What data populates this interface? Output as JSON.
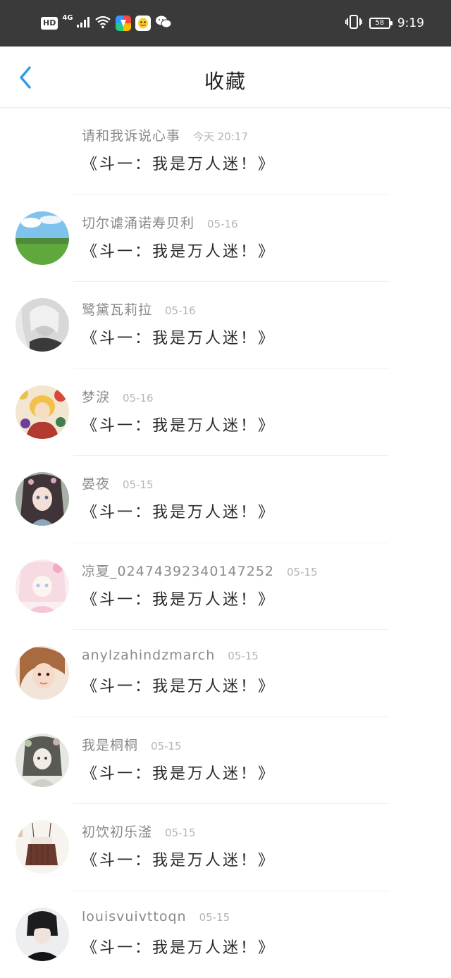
{
  "status_bar": {
    "left_badges": [
      "HD",
      "4G"
    ],
    "time": "9:19",
    "battery": "58",
    "icons": [
      "signal-icon",
      "wifi-icon",
      "app-icon-colorful",
      "app-icon-qq",
      "wechat-icon",
      "vibrate-icon",
      "battery-icon"
    ]
  },
  "header": {
    "title": "收藏",
    "back_icon": "back-chevron-icon"
  },
  "colors": {
    "accent": "#2d9be8",
    "status_bar_bg": "#3a3a3a",
    "username_gray": "#8a8a8a",
    "date_gray": "#b5b5b5"
  },
  "items": [
    {
      "username": "请和我诉说心事",
      "date": "今天 20:17",
      "title": "《斗一：我是万人迷！》",
      "avatar": "none"
    },
    {
      "username": "切尔谑涌诺寿贝利",
      "date": "05-16",
      "title": "《斗一：我是万人迷！》",
      "avatar": "landscape"
    },
    {
      "username": "鹭黛瓦莉拉",
      "date": "05-16",
      "title": "《斗一：我是万人迷！》",
      "avatar": "portrait-bw"
    },
    {
      "username": "梦淚",
      "date": "05-16",
      "title": "《斗一：我是万人迷！》",
      "avatar": "anime-colorful"
    },
    {
      "username": "晏夜",
      "date": "05-15",
      "title": "《斗一：我是万人迷！》",
      "avatar": "anime-girl"
    },
    {
      "username": "凉夏_02474392340147252",
      "date": "05-15",
      "title": "《斗一：我是万人迷！》",
      "avatar": "anime-pastel"
    },
    {
      "username": "anylzahindzmarch",
      "date": "05-15",
      "title": "《斗一：我是万人迷！》",
      "avatar": "portrait-warm"
    },
    {
      "username": "我是桐桐",
      "date": "05-15",
      "title": "《斗一：我是万人迷！》",
      "avatar": "anime-sketch"
    },
    {
      "username": "初饮初乐滏",
      "date": "05-15",
      "title": "《斗一：我是万人迷！》",
      "avatar": "fashion-skirt"
    },
    {
      "username": "louisvuivttoqn",
      "date": "05-15",
      "title": "《斗一：我是万人迷！》",
      "avatar": "portrait-dark"
    }
  ]
}
